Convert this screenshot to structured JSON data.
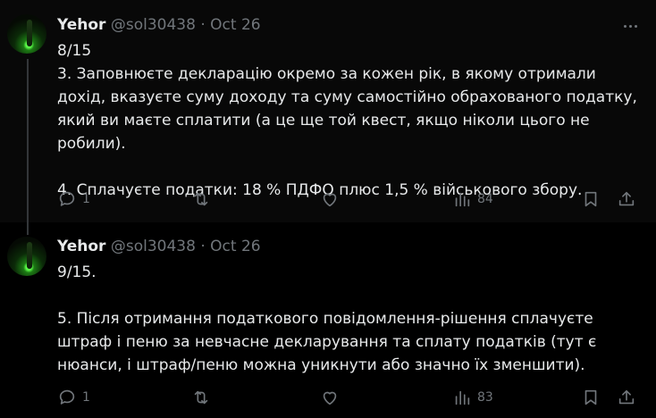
{
  "tweets": [
    {
      "name": "Yehor",
      "handle": "@sol30438",
      "dot": "·",
      "date": "Oct 26",
      "lines": [
        "8/15",
        "3. Заповнюєте декларацію окремо за кожен рік, в якому отримали дохід, вказуєте суму доходу та суму самостійно обрахованого податку, який ви маєте сплатити (а це ще той квест, якщо ніколи цього не робили).",
        "",
        "4. Сплачуєте податки: 18 % ПДФО плюс 1,5 % військового збору."
      ],
      "replies": "1",
      "views": "84"
    },
    {
      "name": "Yehor",
      "handle": "@sol30438",
      "dot": "·",
      "date": "Oct 26",
      "lines": [
        "9/15.",
        "",
        "5. Після отримання податкового повідомлення-рішення сплачуєте штраф і пеню за невчасне декларування та сплату податків (тут є нюанси, і штраф/пеню можна уникнути або значно їх зменшити)."
      ],
      "replies": "1",
      "views": "83"
    }
  ],
  "icons": {
    "reply": "reply-icon",
    "retweet": "retweet-icon",
    "like": "like-icon",
    "views": "views-icon",
    "bookmark": "bookmark-icon",
    "share": "share-icon",
    "more": "more-icon"
  }
}
